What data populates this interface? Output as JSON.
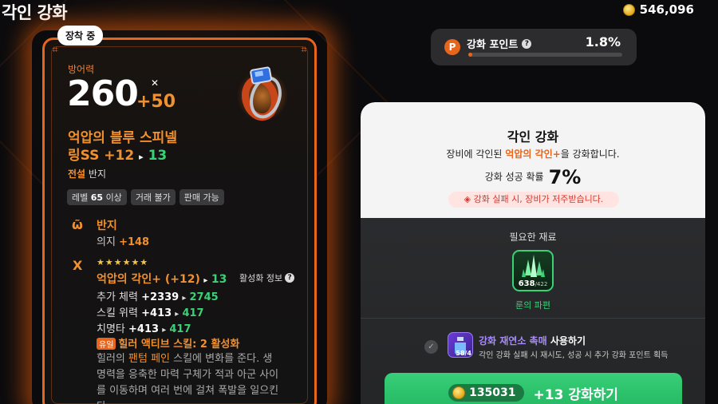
{
  "header": {
    "title": "각인 강화",
    "gold": "546,096"
  },
  "card": {
    "equip_badge": "장착 중",
    "stat_label": "방어력",
    "stat_value": "260",
    "stat_bonus": "+50",
    "item_name_line1": "억압의 블루 스피넬",
    "item_name_line2_prefix": "링SS +12",
    "item_name_line2_arrow": "▸",
    "item_name_line2_next": "13",
    "grade_rarity": "전설",
    "grade_type": "반지",
    "tags": [
      "레벨",
      "65",
      "이상",
      "거래 불가",
      "판매 가능"
    ],
    "section1": {
      "title": "반지",
      "stat_name": "의지",
      "stat_value": "+148"
    },
    "section2": {
      "stars": "★★★★★★",
      "activate_label": "활성화 정보",
      "engrave_name": "억압의 각인+ (+12)",
      "engrave_next": "13",
      "lines": [
        {
          "label": "추가 체력",
          "from": "+2339",
          "to": "2745"
        },
        {
          "label": "스킬 위력",
          "from": "+413",
          "to": "417"
        },
        {
          "label": "치명타",
          "from": "+413",
          "to": "417"
        }
      ],
      "unique_badge": "유일",
      "unique_text": "힐러 액티브 스킬: 2 활성화",
      "desc_1": "힐러의 ",
      "desc_hl": "팬텀 페인",
      "desc_2": " 스킬에 변화를 준다. 생명력을 응축한 마력 구체가 적과 아군 사이를 이동하며 여러 번에 걸쳐 폭발을 일으킨다."
    }
  },
  "points": {
    "label": "강화 포인트",
    "value": "1.8%",
    "progress": 0.018
  },
  "panel": {
    "title": "각인 강화",
    "sub_pre": "장비에 각인된 ",
    "sub_hl": "억압의 각인+",
    "sub_post": "을 강화합니다.",
    "rate_label": "강화 성공 확률",
    "rate_value": "7%",
    "warning": "강화 실패 시, 장비가 저주받습니다.",
    "material_label": "필요한 재료",
    "material_have": "638",
    "material_need": "/422",
    "material_name": "룬의 파편",
    "catalyst_count": "58/4",
    "catalyst_name": "강화 재연소 촉매",
    "catalyst_use": "사용하기",
    "catalyst_desc": "각인 강화 실패 시 재시도, 성공 시 추가 강화 포인트 획득",
    "button_cost": "135031",
    "button_label": "+13 강화하기"
  },
  "colors": {
    "accent": "#e8651c",
    "green": "#3ad277",
    "purple": "#a78bfa"
  }
}
